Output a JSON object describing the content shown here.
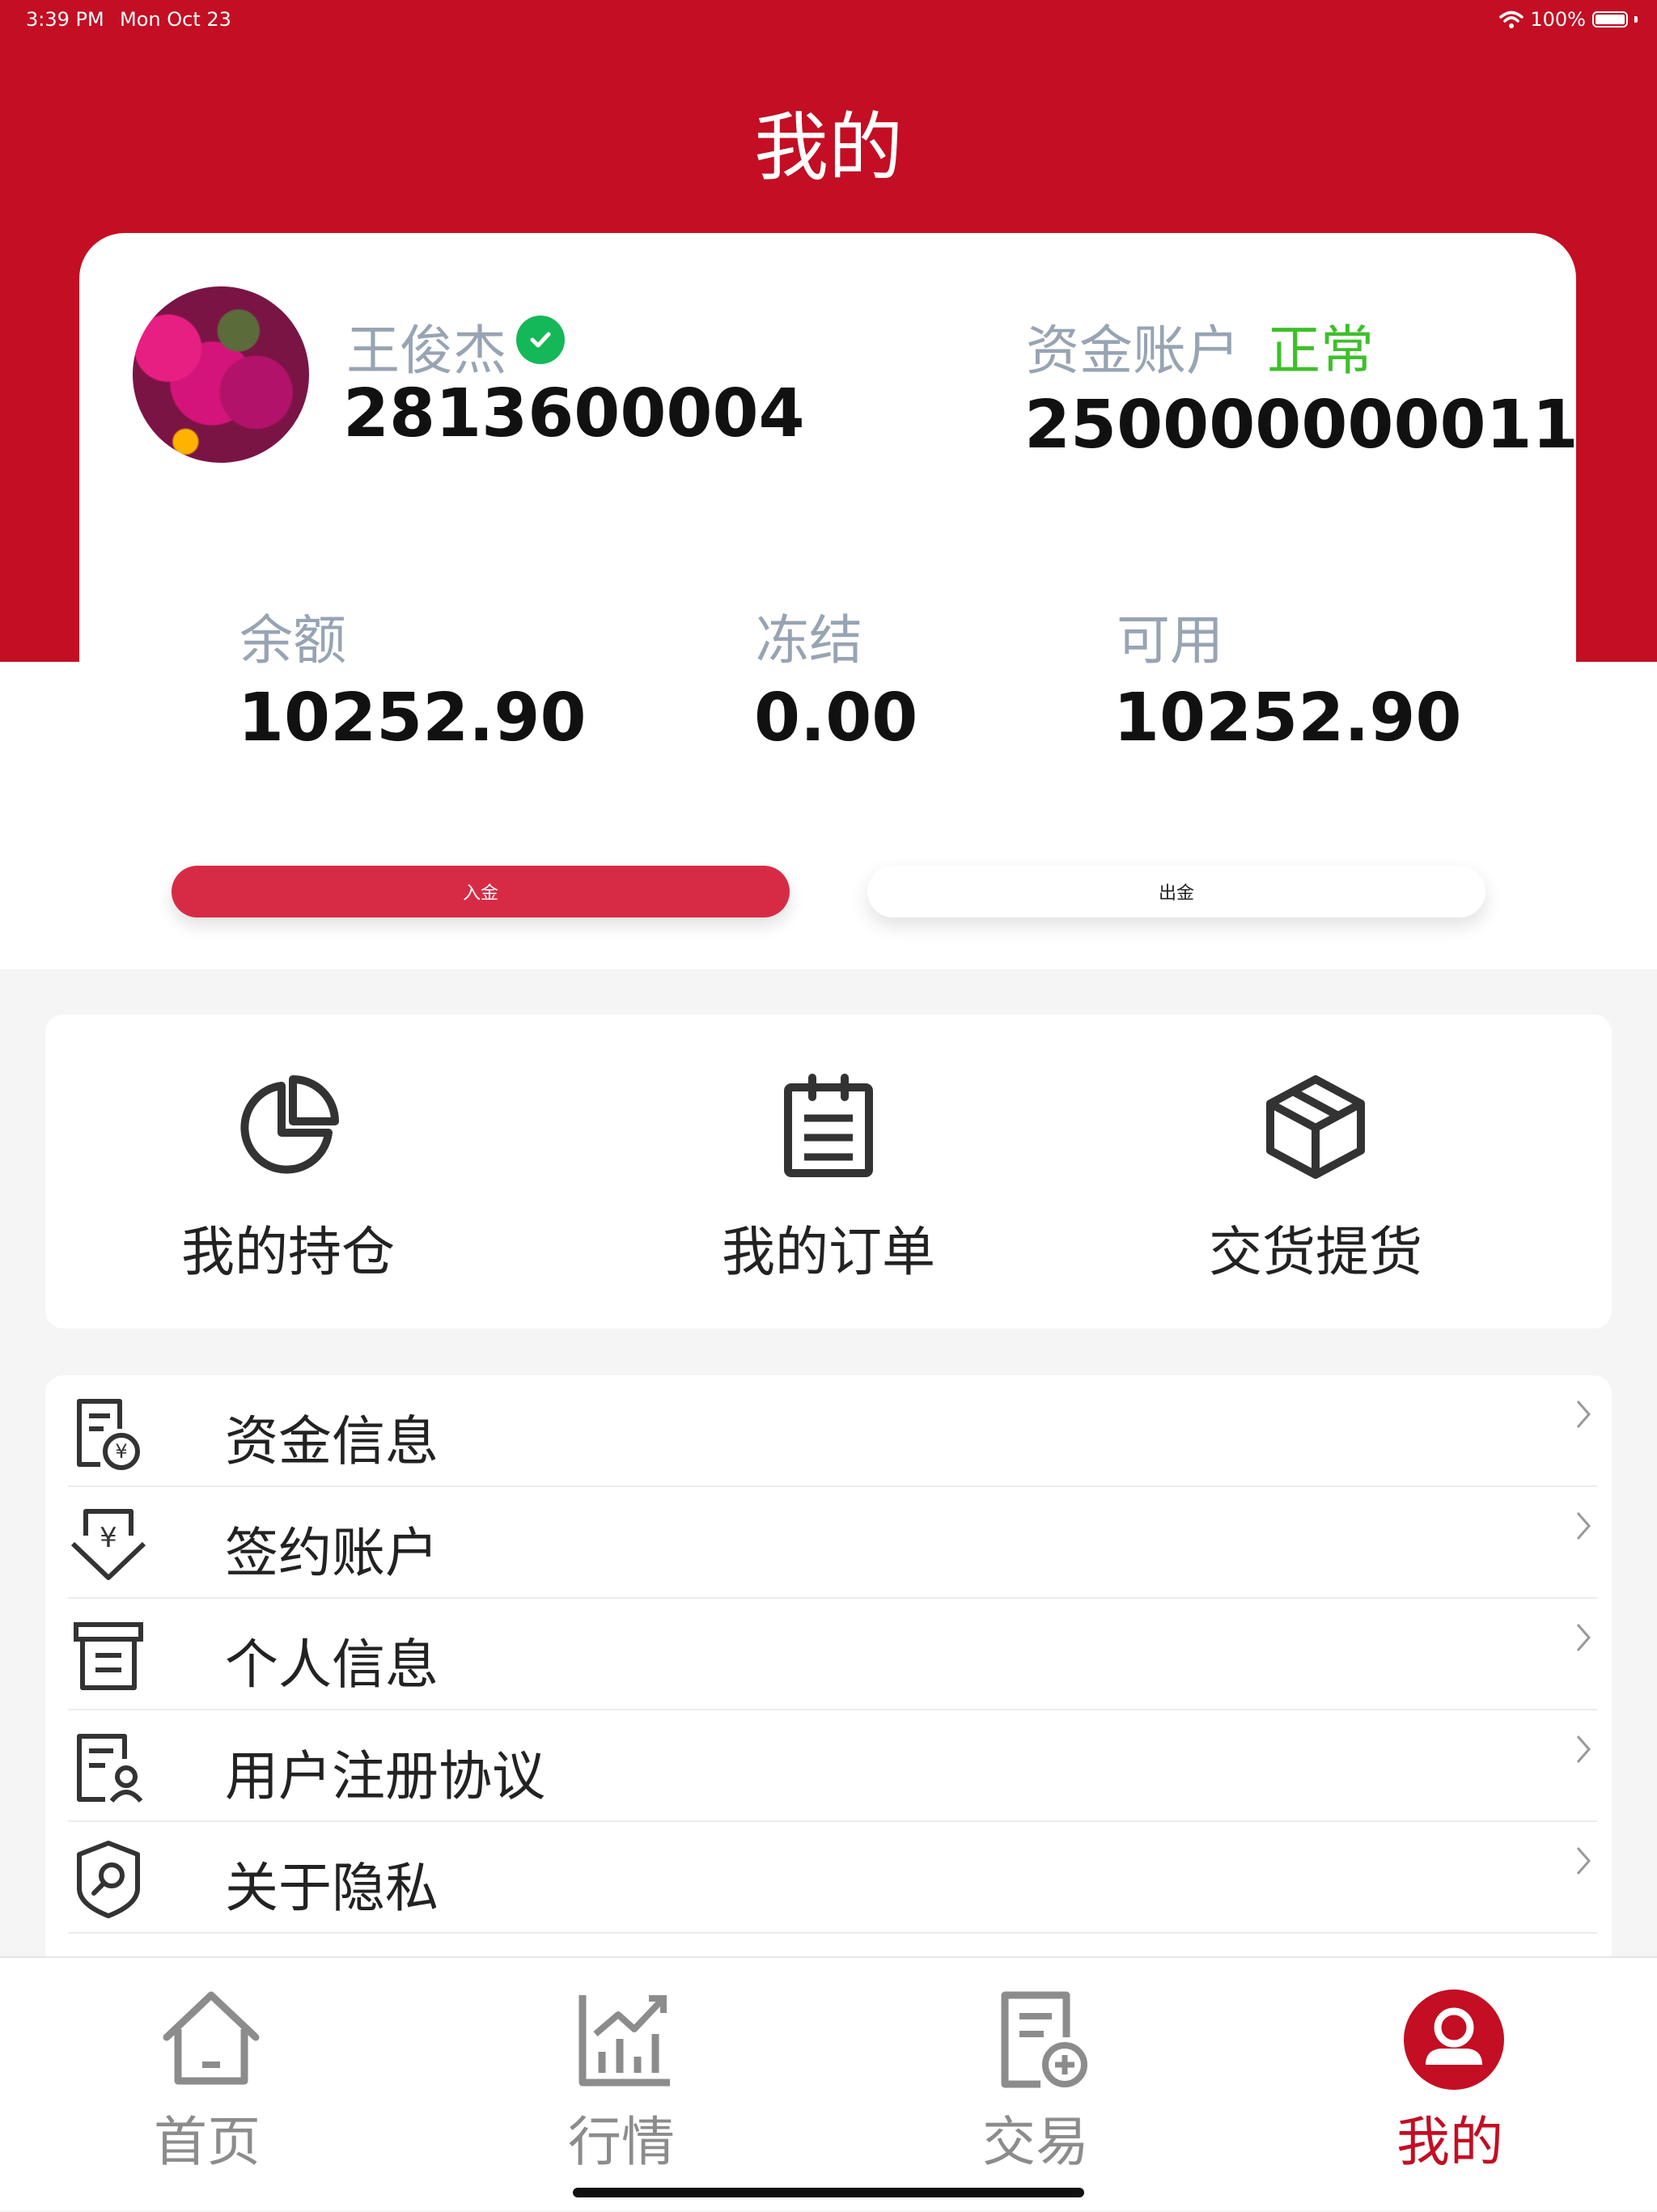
{
  "status_bar": {
    "time": "3:39 PM",
    "date": "Mon Oct 23",
    "battery": "100%"
  },
  "page": {
    "title": "我的"
  },
  "profile": {
    "name": "王俊杰",
    "user_id": "2813600004",
    "account_label": "资金账户",
    "account_status": "正常",
    "account_number": "250000000011"
  },
  "balances": {
    "balance_label": "余额",
    "balance_value": "10252.90",
    "frozen_label": "冻结",
    "frozen_value": "0.00",
    "available_label": "可用",
    "available_value": "10252.90"
  },
  "actions": {
    "deposit": "入金",
    "withdraw": "出金"
  },
  "quick_actions": [
    {
      "label": "我的持仓",
      "icon": "pie-chart-icon"
    },
    {
      "label": "我的订单",
      "icon": "clipboard-icon"
    },
    {
      "label": "交货提货",
      "icon": "box-icon"
    }
  ],
  "menu": [
    {
      "label": "资金信息",
      "icon": "fund-document-icon"
    },
    {
      "label": "签约账户",
      "icon": "yuan-shield-icon"
    },
    {
      "label": "个人信息",
      "icon": "id-card-icon"
    },
    {
      "label": "用户注册协议",
      "icon": "user-document-icon"
    },
    {
      "label": "关于隐私",
      "icon": "privacy-shield-icon"
    }
  ],
  "tabs": [
    {
      "label": "首页",
      "icon": "home-icon"
    },
    {
      "label": "行情",
      "icon": "market-chart-icon"
    },
    {
      "label": "交易",
      "icon": "trade-document-icon"
    },
    {
      "label": "我的",
      "icon": "user-icon",
      "active": true
    }
  ],
  "colors": {
    "brand_red": "#c30e23",
    "status_green": "#3fbf2b",
    "muted": "#98a4b3"
  }
}
